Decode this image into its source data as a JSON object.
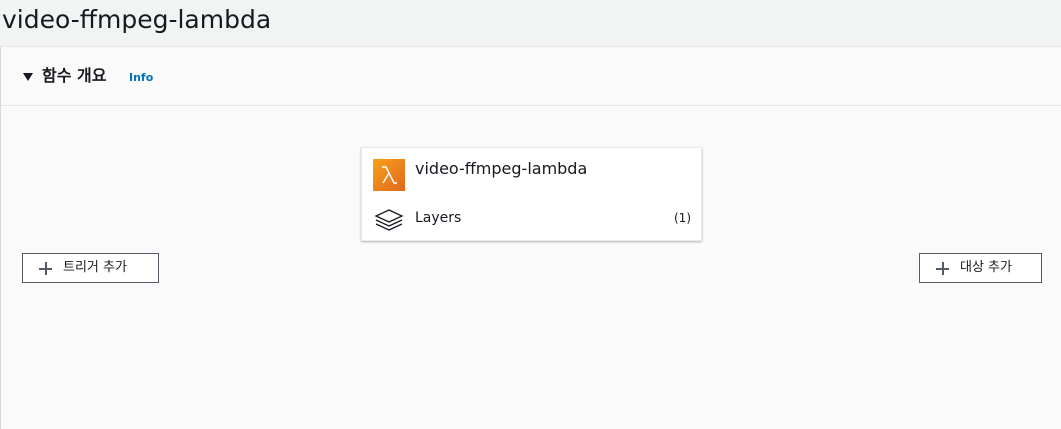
{
  "page": {
    "title": "video-ffmpeg-lambda"
  },
  "overview": {
    "section_title": "함수 개요",
    "info_link": "Info",
    "function": {
      "name": "video-ffmpeg-lambda",
      "icon": "lambda-icon",
      "icon_color": "#e8751c"
    },
    "layers": {
      "label": "Layers",
      "count": "(1)",
      "icon": "layers-icon"
    },
    "add_trigger_label": "트리거 추가",
    "add_destination_label": "대상 추가"
  },
  "colors": {
    "link": "#0073bb",
    "text": "#16191f",
    "button_border": "#545b64"
  }
}
